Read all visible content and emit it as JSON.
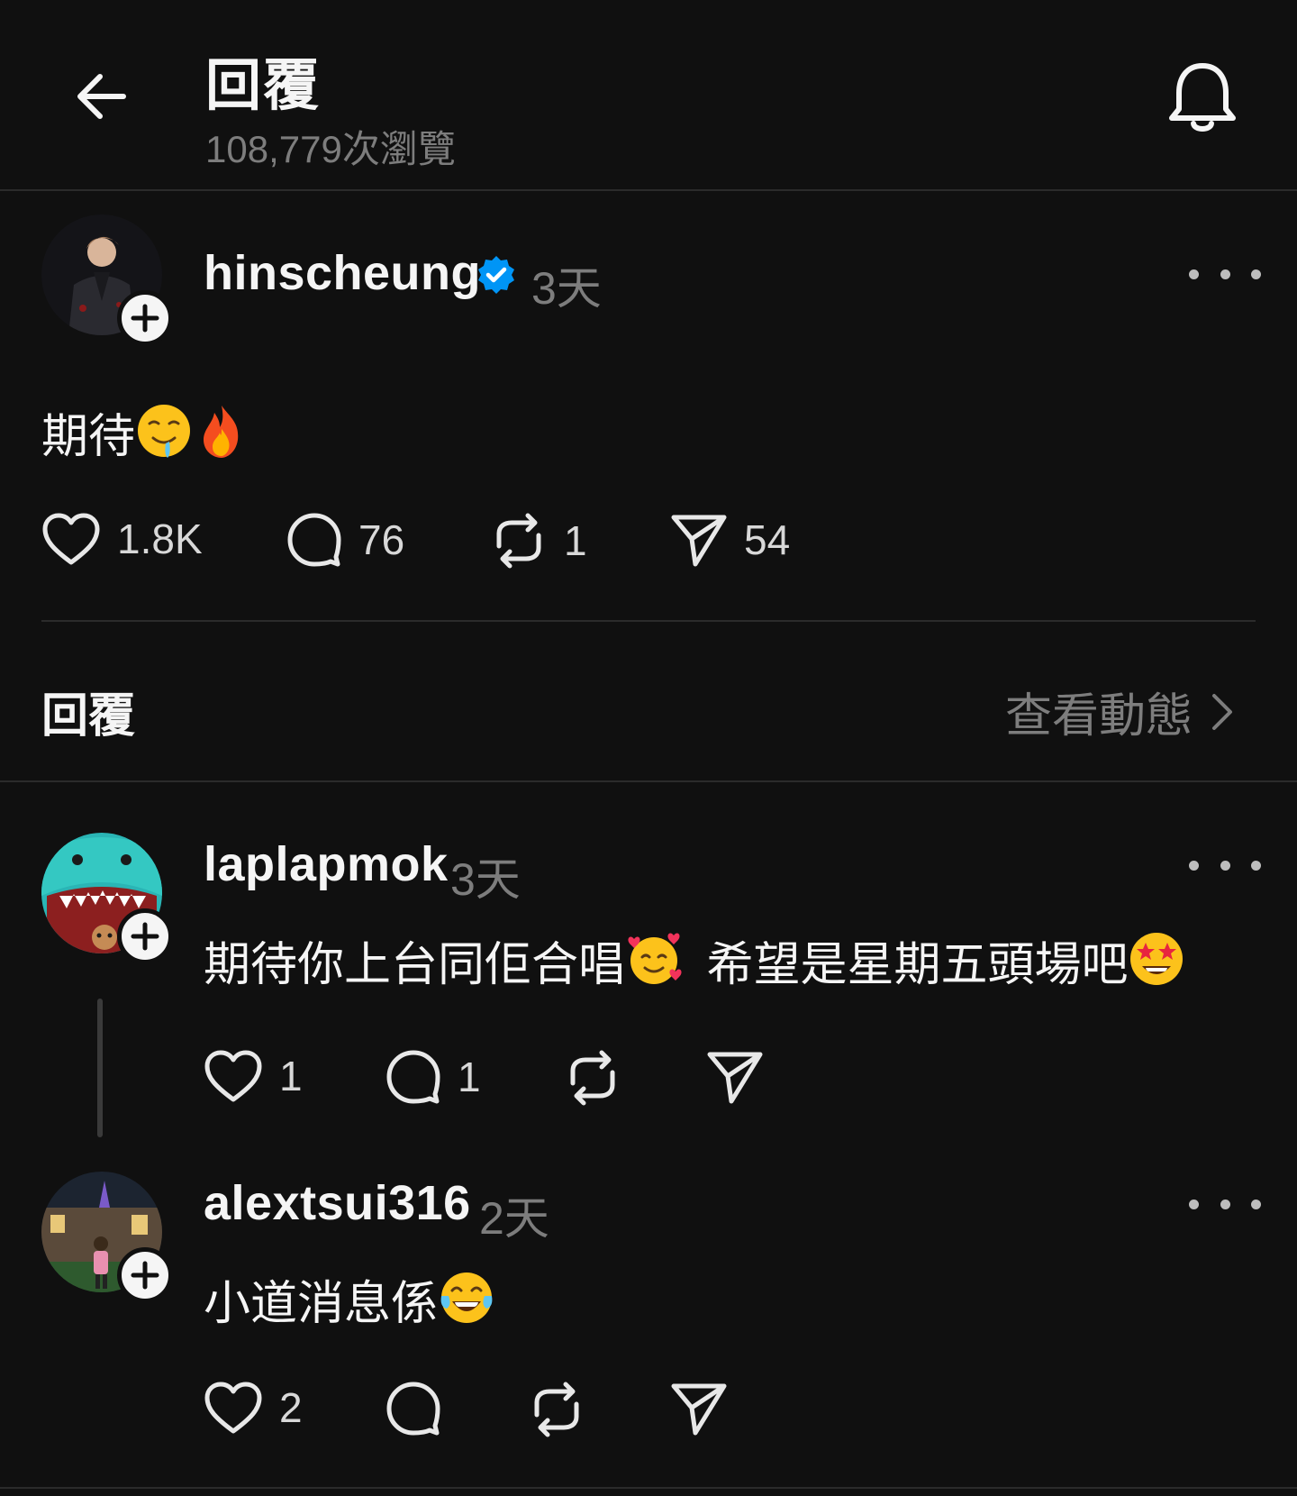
{
  "header": {
    "title": "回覆",
    "views": "108,779次瀏覽"
  },
  "post": {
    "username": "hinscheung",
    "verified": true,
    "time": "3天",
    "text": "期待",
    "emojis": [
      "drooling-face",
      "fire"
    ],
    "likes": "1.8K",
    "replies": "76",
    "reposts": "1",
    "shares": "54"
  },
  "replies_section": {
    "heading": "回覆",
    "view_activity": "查看動態"
  },
  "replies": [
    {
      "username": "laplapmok",
      "time": "3天",
      "text_part1": "期待你上台同佢合唱",
      "text_part2": "希望是星期五頭場吧",
      "emojis": [
        "smiling-face-with-hearts",
        "star-struck"
      ],
      "likes": "1",
      "replies": "1"
    },
    {
      "username": "alextsui316",
      "time": "2天",
      "text": "小道消息係",
      "emojis": [
        "face-with-tears-of-joy"
      ],
      "likes": "2"
    }
  ],
  "colors": {
    "background": "#101010",
    "text_primary": "#f5f5f5",
    "text_secondary": "#7d7d7d",
    "verified": "#0095f6",
    "divider": "#2b2b2b"
  }
}
